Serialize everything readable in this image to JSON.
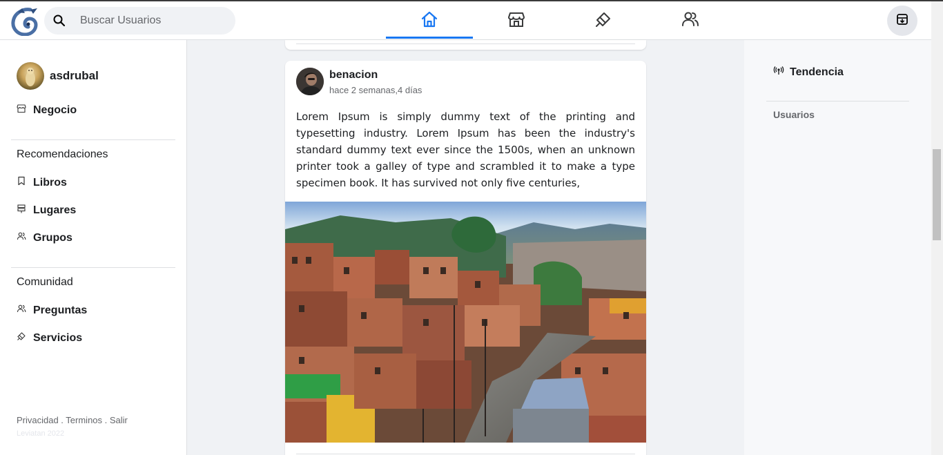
{
  "header": {
    "search_placeholder": "Buscar Usuarios",
    "nav": [
      {
        "icon": "home-icon",
        "active": true
      },
      {
        "icon": "store-icon",
        "active": false
      },
      {
        "icon": "tools-icon",
        "active": false
      },
      {
        "icon": "users-icon",
        "active": false
      }
    ],
    "action_icon": "archive-icon"
  },
  "sidebar": {
    "user_name": "asdrubal",
    "business_label": "Negocio",
    "recommendations_title": "Recomendaciones",
    "recommendations": [
      {
        "label": "Libros",
        "icon": "bookmark-icon"
      },
      {
        "label": "Lugares",
        "icon": "signpost-icon"
      },
      {
        "label": "Grupos",
        "icon": "users-icon"
      }
    ],
    "community_title": "Comunidad",
    "community": [
      {
        "label": "Preguntas",
        "icon": "users-icon"
      },
      {
        "label": "Servicios",
        "icon": "tools-icon"
      }
    ],
    "footer_links": "Privacidad . Terminos . Salir",
    "footer_brand": "Leviatan 2022"
  },
  "post": {
    "author": "benacion",
    "time": "hace 2 semanas,4 días",
    "text": "Lorem Ipsum is simply dummy text of the printing and typesetting industry. Lorem Ipsum has been the industry's standard dummy text ever since the 1500s, when an unknown printer took a galley of type and scrambled it to make a type specimen book. It has survived not only five centuries,"
  },
  "right": {
    "trend_title": "Tendencia",
    "users_label": "Usuarios"
  },
  "colors": {
    "accent": "#1877f2",
    "background": "#f0f2f5"
  }
}
